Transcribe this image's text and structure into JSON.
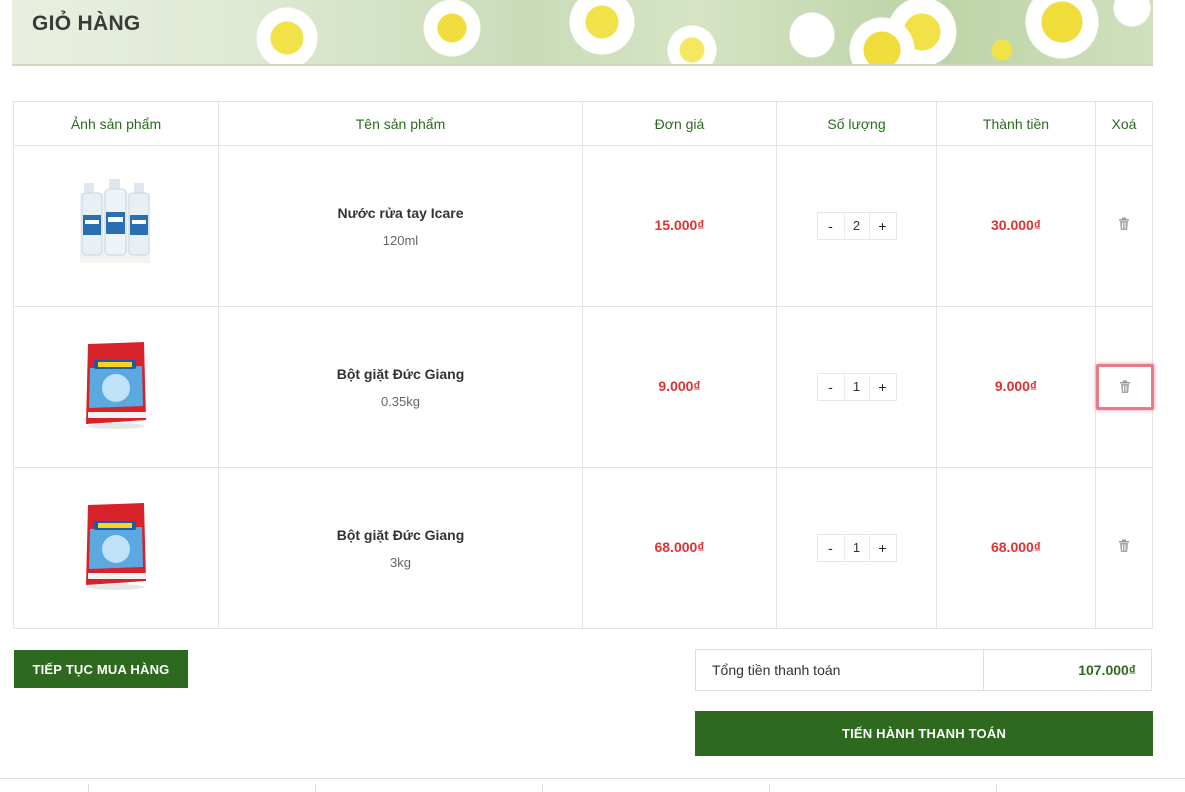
{
  "page": {
    "title": "GIỎ HÀNG"
  },
  "table": {
    "headers": {
      "image": "Ảnh sản phẩm",
      "name": "Tên sản phẩm",
      "unit_price": "Đơn giá",
      "quantity": "Số lượng",
      "line_total": "Thành tiền",
      "delete": "Xoá"
    },
    "rows": [
      {
        "name": "Nước rửa tay Icare",
        "variant": "120ml",
        "unit_price": "15.000₫",
        "quantity": "2",
        "line_total": "30.000₫",
        "image_icon": "hand-sanitizer-bottles-image"
      },
      {
        "name": "Bột giặt Đức Giang",
        "variant": "0.35kg",
        "unit_price": "9.000₫",
        "quantity": "1",
        "line_total": "9.000₫",
        "image_icon": "detergent-bag-image"
      },
      {
        "name": "Bột giặt Đức Giang",
        "variant": "3kg",
        "unit_price": "68.000₫",
        "quantity": "1",
        "line_total": "68.000₫",
        "image_icon": "detergent-bag-image"
      }
    ],
    "qty_minus": "-",
    "qty_plus": "+"
  },
  "actions": {
    "continue_label": "TIẾP TỤC MUA HÀNG",
    "checkout_label": "TIẾN HÀNH THANH TOÁN"
  },
  "summary": {
    "total_label": "Tổng tiền thanh toán",
    "total_value": "107.000₫"
  },
  "colors": {
    "primary_green": "#2d6a1f",
    "price_red": "#e03131",
    "highlight_pink": "#e87b8a"
  }
}
